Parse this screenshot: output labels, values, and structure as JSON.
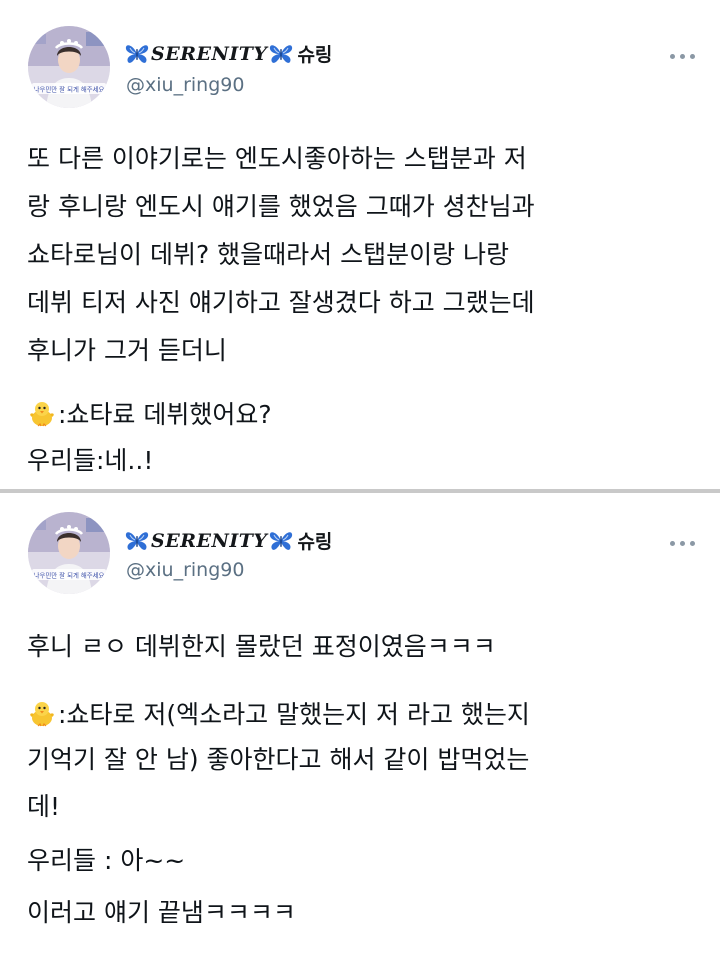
{
  "tweets": [
    {
      "author": {
        "display_name": "SERENITY",
        "name_suffix": "슈링",
        "handle": "@xiu_ring90",
        "avatar_caption": "나우민만 잘 되게 해주세요"
      },
      "menu_icon": "more-horizontal-icon",
      "lines": [
        "또 다른 이야기로는 엔도시좋아하는 스탭분과 저",
        "랑 후니랑 엔도시 얘기를 했었음 그때가 셩찬님과",
        "쇼타로님이 데뷔? 했을때라서 스탭분이랑 나랑",
        "데뷔 티저 사진 얘기하고 잘생겼다 하고 그랬는데",
        "후니가 그거 듣더니",
        ":쇼타료 데뷔했어요?",
        "우리들:네..!"
      ]
    },
    {
      "author": {
        "display_name": "SERENITY",
        "name_suffix": "슈링",
        "handle": "@xiu_ring90",
        "avatar_caption": "나우민만 잘 되게 해주세요"
      },
      "menu_icon": "more-horizontal-icon",
      "lines": [
        "후니 ㄹㅇ 데뷔한지 몰랐던 표정이였음ㅋㅋㅋ",
        ":쇼타로 저(엑소라고 말했는지 저 라고 했는지",
        "기억기 잘 안 남) 좋아한다고 해서 같이 밥먹었는",
        "데!",
        "우리들 : 아~~",
        "이러고 얘기 끝냄ㅋㅋㅋㅋ"
      ]
    }
  ],
  "colors": {
    "butterfly": "#2f6fd6",
    "handle": "#5b7083",
    "text": "#0f1419",
    "divider": "#c9c9c9"
  }
}
